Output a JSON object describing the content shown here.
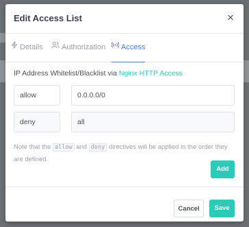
{
  "modal": {
    "title": "Edit Access List",
    "close_icon": "close-icon"
  },
  "tabs": [
    {
      "label": "Details",
      "icon": "lightning-icon",
      "active": false
    },
    {
      "label": "Authorization",
      "icon": "users-icon",
      "active": false
    },
    {
      "label": "Access",
      "icon": "wifi-icon",
      "active": true
    }
  ],
  "access": {
    "desc_prefix": "IP Address Whitelist/Blacklist via ",
    "desc_link": "Nginx HTTP Access",
    "rules": [
      {
        "directive": "allow",
        "address": "0.0.0.0/0"
      },
      {
        "directive": "deny",
        "address": "all"
      }
    ],
    "note_prefix": "Note that the ",
    "note_code_allow": "allow",
    "note_and": " and ",
    "note_code_deny": "deny",
    "note_suffix": " directives will be applied in the order they are defined.",
    "add_label": "Add"
  },
  "footer": {
    "cancel_label": "Cancel",
    "save_label": "Save"
  },
  "colors": {
    "accent": "#2bcbba",
    "tab_active": "#467fcf"
  }
}
